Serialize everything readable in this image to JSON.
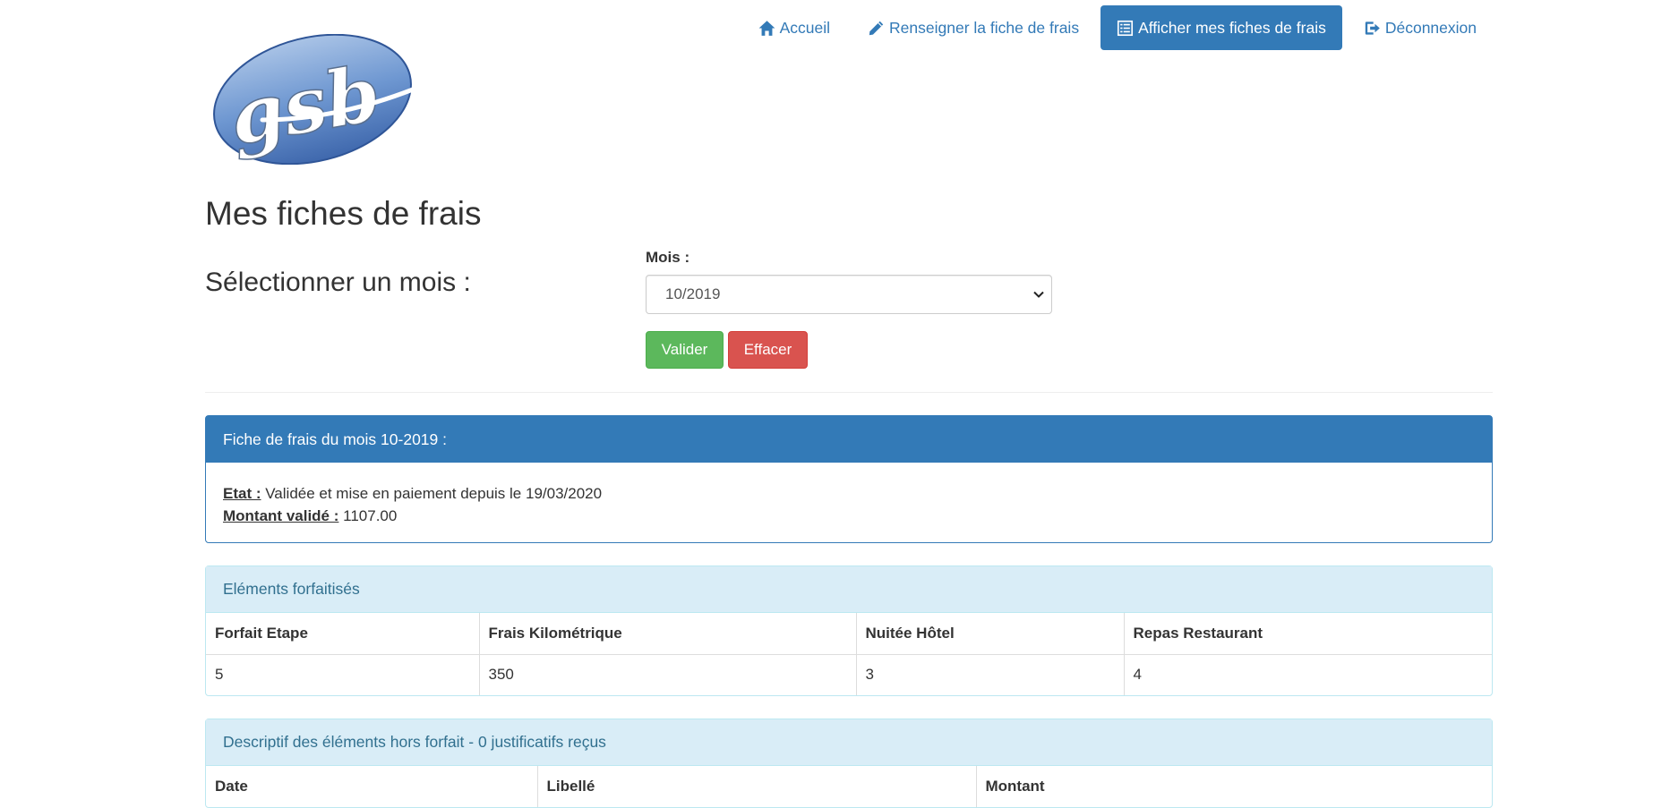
{
  "nav": {
    "items": [
      {
        "label": "Accueil",
        "icon": "home-icon",
        "active": false
      },
      {
        "label": "Renseigner la fiche de frais",
        "icon": "pencil-icon",
        "active": false
      },
      {
        "label": "Afficher mes fiches de frais",
        "icon": "list-alt-icon",
        "active": true
      },
      {
        "label": "Déconnexion",
        "icon": "log-out-icon",
        "active": false
      }
    ]
  },
  "logo": {
    "text": "gsb"
  },
  "page": {
    "title": "Mes fiches de frais",
    "subtitle": "Sélectionner un mois :"
  },
  "form": {
    "mois_label": "Mois :",
    "mois_selected": "10/2019",
    "valider_label": "Valider",
    "effacer_label": "Effacer"
  },
  "fiche": {
    "header": "Fiche de frais du mois 10-2019 :",
    "etat_label": "Etat :",
    "etat_value": "Validée et mise en paiement depuis le 19/03/2020",
    "montant_label": "Montant validé :",
    "montant_value": "1107.00"
  },
  "forfait": {
    "header": "Eléments forfaitisés",
    "columns": [
      "Forfait Etape",
      "Frais Kilométrique",
      "Nuitée Hôtel",
      "Repas Restaurant"
    ],
    "values": [
      "5",
      "350",
      "3",
      "4"
    ]
  },
  "hors_forfait": {
    "header": "Descriptif des éléments hors forfait - 0 justificatifs reçus",
    "columns": [
      "Date",
      "Libellé",
      "Montant"
    ]
  },
  "colors": {
    "primary": "#337ab7",
    "success": "#5cb85c",
    "danger": "#d9534f",
    "info_bg": "#d9edf7",
    "info_text": "#31708f"
  }
}
